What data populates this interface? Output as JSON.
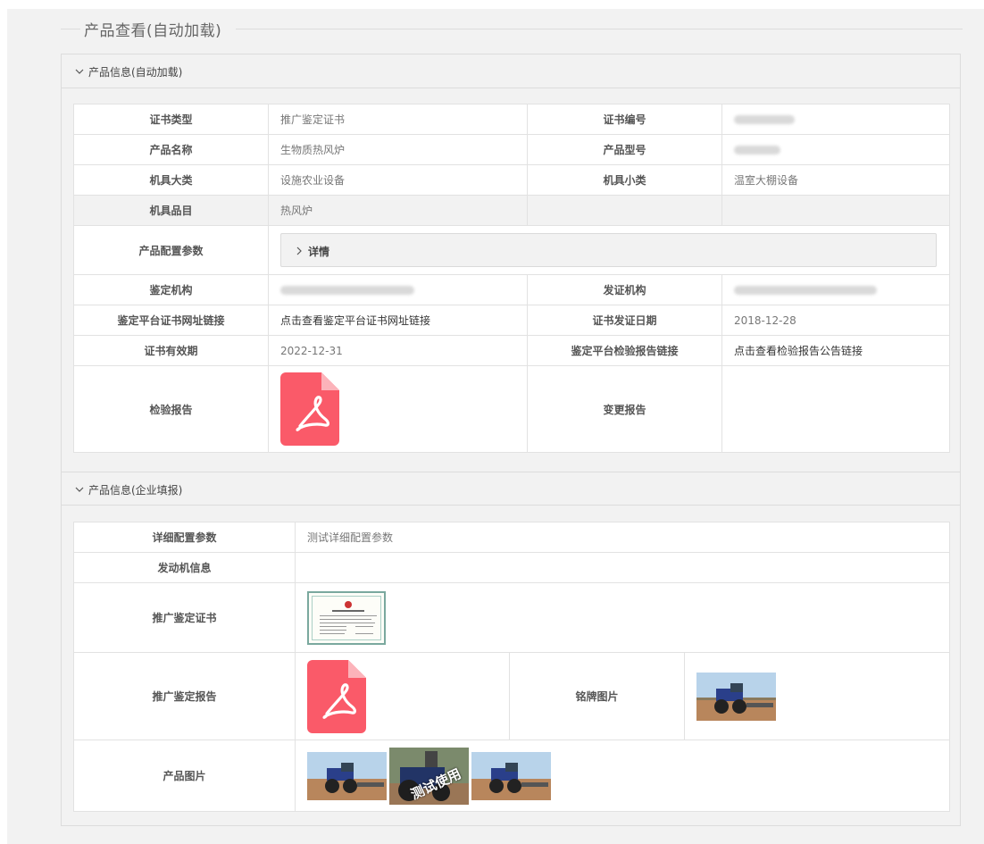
{
  "page": {
    "title": "产品查看(自动加载)"
  },
  "section_auto": {
    "header": "产品信息(自动加载)",
    "rows": {
      "cert_type_label": "证书类型",
      "cert_type_value": "推广鉴定证书",
      "cert_no_label": "证书编号",
      "product_name_label": "产品名称",
      "product_name_value": "生物质热风炉",
      "product_model_label": "产品型号",
      "machine_major_label": "机具大类",
      "machine_major_value": "设施农业设备",
      "machine_minor_label": "机具小类",
      "machine_minor_value": "温室大棚设备",
      "machine_item_label": "机具品目",
      "machine_item_value": "热风炉",
      "config_label": "产品配置参数",
      "config_detail": "详情",
      "appraisal_org_label": "鉴定机构",
      "issuing_org_label": "发证机构",
      "platform_cert_link_label": "鉴定平台证书网址链接",
      "platform_cert_link_value": "点击查看鉴定平台证书网址链接",
      "issue_date_label": "证书发证日期",
      "issue_date_value": "2018-12-28",
      "valid_until_label": "证书有效期",
      "valid_until_value": "2022-12-31",
      "platform_report_link_label": "鉴定平台检验报告链接",
      "platform_report_link_value": "点击查看检验报告公告链接",
      "inspection_report_label": "检验报告",
      "change_report_label": "变更报告"
    }
  },
  "section_ent": {
    "header": "产品信息(企业填报)",
    "rows": {
      "detail_config_label": "详细配置参数",
      "detail_config_value": "测试详细配置参数",
      "engine_label": "发动机信息",
      "promo_cert_label": "推广鉴定证书",
      "promo_report_label": "推广鉴定报告",
      "nameplate_label": "铭牌图片",
      "product_images_label": "产品图片",
      "watermark": "测试使用"
    }
  },
  "colors": {
    "pdf_red": "#fa5a69",
    "background": "#f2f2f2",
    "border": "#e2e2e2"
  },
  "icons": [
    "chevron-down-icon",
    "chevron-right-icon",
    "pdf-icon"
  ]
}
